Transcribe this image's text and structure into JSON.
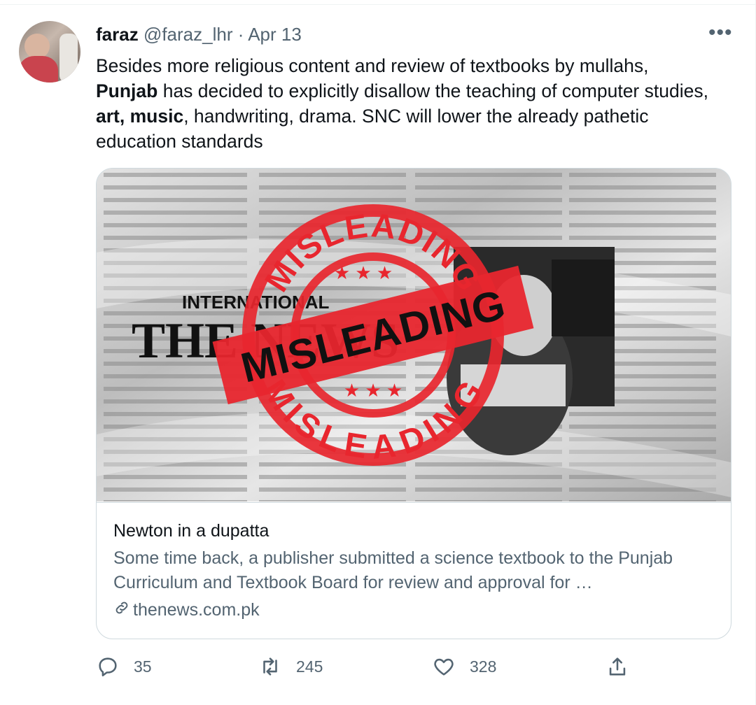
{
  "tweet": {
    "author_name": "faraz",
    "handle": "@faraz_lhr",
    "separator": "·",
    "date": "Apr 13",
    "more_label": "•••",
    "text_segments": [
      {
        "text": "Besides more religious content and review of textbooks by mullahs, ",
        "bold": false
      },
      {
        "text": "Punjab",
        "bold": true
      },
      {
        "text": " has decided to explicitly disallow the teaching of computer studies, ",
        "bold": false
      },
      {
        "text": "art, music",
        "bold": true
      },
      {
        "text": ", handwriting, drama. SNC will lower the already pathetic education standards",
        "bold": false
      }
    ]
  },
  "card": {
    "image": {
      "masthead_small": "INTERNATIONAL",
      "masthead_large": "THE NEWS",
      "stamp_top": "MISLEADING",
      "stamp_band": "MISLEADING",
      "stamp_bottom": "MISLEADING",
      "stamp_color": "#e8262e"
    },
    "title": "Newton in a dupatta",
    "description": "Some time back, a publisher submitted a science textbook to the Punjab Curriculum and Textbook Board for review and approval for …",
    "domain": "thenews.com.pk"
  },
  "actions": {
    "reply_count": "35",
    "retweet_count": "245",
    "like_count": "328",
    "icons": [
      "reply-icon",
      "retweet-icon",
      "like-icon",
      "share-icon"
    ]
  },
  "colors": {
    "primary_text": "#0f1419",
    "secondary_text": "#536471",
    "border": "#cfd9de"
  }
}
